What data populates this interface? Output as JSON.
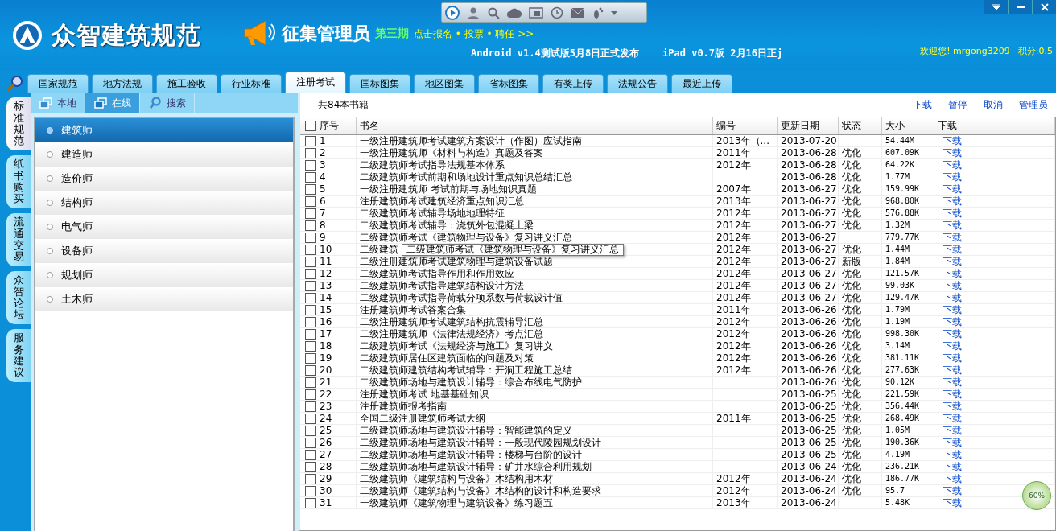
{
  "header": {
    "app_title": "众智建筑规范",
    "promo_title": "征集管理员",
    "promo_issue": "第三期",
    "promo_link": "点击报名 • 投票 • 聘任 >>",
    "news": "Android v1.4测试版5月8日正式发布    iPad v0.7版 2月16日正j",
    "welcome": "欢迎您! mrgong3209",
    "points": "积分:0.5"
  },
  "tabs": [
    {
      "label": "国家规范",
      "selected": false
    },
    {
      "label": "地方法规",
      "selected": false
    },
    {
      "label": "施工验收",
      "selected": false
    },
    {
      "label": "行业标准",
      "selected": false
    },
    {
      "label": "注册考试",
      "selected": true
    },
    {
      "label": "国标图集",
      "selected": false
    },
    {
      "label": "地区图集",
      "selected": false
    },
    {
      "label": "省标图集",
      "selected": false
    },
    {
      "label": "有奖上传",
      "selected": false
    },
    {
      "label": "法规公告",
      "selected": false
    },
    {
      "label": "最近上传",
      "selected": false
    }
  ],
  "side_tabs": [
    {
      "label": "标准规范",
      "selected": true
    },
    {
      "label": "纸书购买",
      "selected": false
    },
    {
      "label": "流通交易",
      "selected": false
    },
    {
      "label": "众智论坛",
      "selected": false
    },
    {
      "label": "服务建议",
      "selected": false
    }
  ],
  "source_tabs": [
    {
      "label": "本地",
      "selected": false,
      "kind": "local"
    },
    {
      "label": "在线",
      "selected": true,
      "kind": "online"
    },
    {
      "label": "搜索",
      "selected": false,
      "kind": "search"
    }
  ],
  "categories": [
    {
      "label": "建筑师",
      "selected": true
    },
    {
      "label": "建造师",
      "selected": false
    },
    {
      "label": "造价师",
      "selected": false
    },
    {
      "label": "结构师",
      "selected": false
    },
    {
      "label": "电气师",
      "selected": false
    },
    {
      "label": "设备师",
      "selected": false
    },
    {
      "label": "规划师",
      "selected": false
    },
    {
      "label": "土木师",
      "selected": false
    }
  ],
  "table": {
    "count": "共84本书籍",
    "actions": [
      "下载",
      "暂停",
      "取消",
      "管理员"
    ],
    "select_all": {
      "checked": false
    },
    "columns": [
      "序号",
      "书名",
      "编号",
      "更新日期",
      "状态",
      "大小",
      "下载"
    ],
    "rows": [
      {
        "checked": false,
        "no": "1",
        "title": "一级注册建筑师考试建筑方案设计（作图）应试指南",
        "code": "2013年（...",
        "date": "2013-07-20",
        "status": "",
        "size": "54.44M",
        "download": "下载"
      },
      {
        "checked": false,
        "no": "2",
        "title": "一级注册建筑师《材料与构造》真题及答案",
        "code": "2011年",
        "date": "2013-06-28",
        "status": "优化",
        "size": "607.09K",
        "download": "下载"
      },
      {
        "checked": false,
        "no": "3",
        "title": "二级建筑师考试指导法规基本体系",
        "code": "2012年",
        "date": "2013-06-28",
        "status": "优化",
        "size": "64.22K",
        "download": "下载"
      },
      {
        "checked": false,
        "no": "4",
        "title": "二级建筑师考试前期和场地设计重点知识总结汇总",
        "code": "",
        "date": "2013-06-28",
        "status": "优化",
        "size": "1.77M",
        "download": "下载"
      },
      {
        "checked": false,
        "no": "5",
        "title": "一级注册建筑师 考试前期与场地知识真题",
        "code": "2007年",
        "date": "2013-06-27",
        "status": "优化",
        "size": "159.99K",
        "download": "下载"
      },
      {
        "checked": false,
        "no": "6",
        "title": "注册建筑师考试建筑经济重点知识汇总",
        "code": "2013年",
        "date": "2013-06-27",
        "status": "优化",
        "size": "968.80K",
        "download": "下载"
      },
      {
        "checked": false,
        "no": "7",
        "title": "二级建筑师考试辅导场地地理特征",
        "code": "2012年",
        "date": "2013-06-27",
        "status": "优化",
        "size": "576.88K",
        "download": "下载"
      },
      {
        "checked": false,
        "no": "8",
        "title": "二级建筑师考试辅导：浇筑外包混凝土梁",
        "code": "2012年",
        "date": "2013-06-27",
        "status": "优化",
        "size": "1.32M",
        "download": "下载"
      },
      {
        "checked": false,
        "no": "9",
        "title": "二级建筑师考试《建筑物理与设备》复习讲义汇总",
        "code": "2012年",
        "date": "2013-06-27",
        "status": "",
        "size": "779.77K",
        "download": "下载"
      },
      {
        "checked": false,
        "no": "10",
        "title": "二级建筑",
        "code": "2012年",
        "date": "2013-06-27",
        "status": "优化",
        "size": "1.44M",
        "download": "下载"
      },
      {
        "checked": false,
        "no": "11",
        "title": "二级注册建筑师考试建筑物理与建筑设备试题",
        "code": "2012年",
        "date": "2013-06-27",
        "status": "新版",
        "size": "1.84M",
        "download": "下载"
      },
      {
        "checked": false,
        "no": "12",
        "title": "二级建筑师考试指导作用和作用效应",
        "code": "2012年",
        "date": "2013-06-27",
        "status": "优化",
        "size": "121.57K",
        "download": "下载"
      },
      {
        "checked": false,
        "no": "13",
        "title": "二级建筑师考试指导建筑结构设计方法",
        "code": "2012年",
        "date": "2013-06-27",
        "status": "优化",
        "size": "99.03K",
        "download": "下载"
      },
      {
        "checked": false,
        "no": "14",
        "title": "二级建筑师考试指导荷载分项系数与荷载设计值",
        "code": "2012年",
        "date": "2013-06-27",
        "status": "优化",
        "size": "129.47K",
        "download": "下载"
      },
      {
        "checked": false,
        "no": "15",
        "title": "注册建筑师考试答案合集",
        "code": "2011年",
        "date": "2013-06-26",
        "status": "优化",
        "size": "1.79M",
        "download": "下载"
      },
      {
        "checked": false,
        "no": "16",
        "title": "二级注册建筑师考试建筑结构抗震辅导汇总",
        "code": "2012年",
        "date": "2013-06-26",
        "status": "优化",
        "size": "1.19M",
        "download": "下载"
      },
      {
        "checked": false,
        "no": "17",
        "title": "二级注册建筑师《法律法规经济》考点汇总",
        "code": "2012年",
        "date": "2013-06-26",
        "status": "优化",
        "size": "998.30K",
        "download": "下载"
      },
      {
        "checked": false,
        "no": "18",
        "title": "二级建筑师考试《法规经济与施工》复习讲义",
        "code": "2012年",
        "date": "2013-06-26",
        "status": "优化",
        "size": "3.14M",
        "download": "下载"
      },
      {
        "checked": false,
        "no": "19",
        "title": "二级建筑师居住区建筑面临的问题及对策",
        "code": "2012年",
        "date": "2013-06-26",
        "status": "优化",
        "size": "381.11K",
        "download": "下载"
      },
      {
        "checked": false,
        "no": "20",
        "title": "二级建筑师建筑结构考试辅导：开洞工程施工总结",
        "code": "2012年",
        "date": "2013-06-26",
        "status": "优化",
        "size": "277.63K",
        "download": "下载"
      },
      {
        "checked": false,
        "no": "21",
        "title": "二级建筑师场地与建筑设计辅导：综合布线电气防护",
        "code": "",
        "date": "2013-06-26",
        "status": "优化",
        "size": "90.12K",
        "download": "下载"
      },
      {
        "checked": false,
        "no": "22",
        "title": "注册建筑师考试 地基基础知识",
        "code": "",
        "date": "2013-06-25",
        "status": "优化",
        "size": "221.59K",
        "download": "下载"
      },
      {
        "checked": false,
        "no": "23",
        "title": "注册建筑师报考指南",
        "code": "",
        "date": "2013-06-25",
        "status": "优化",
        "size": "356.44K",
        "download": "下载"
      },
      {
        "checked": false,
        "no": "24",
        "title": "全国二级注册建筑师考试大纲",
        "code": "2011年",
        "date": "2013-06-25",
        "status": "优化",
        "size": "268.49K",
        "download": "下载"
      },
      {
        "checked": false,
        "no": "25",
        "title": "二级建筑师场地与建筑设计辅导：智能建筑的定义",
        "code": "",
        "date": "2013-06-25",
        "status": "优化",
        "size": "1.05M",
        "download": "下载"
      },
      {
        "checked": false,
        "no": "26",
        "title": "二级建筑师场地与建筑设计辅导：一般现代陵园规划设计",
        "code": "",
        "date": "2013-06-25",
        "status": "优化",
        "size": "190.36K",
        "download": "下载"
      },
      {
        "checked": false,
        "no": "27",
        "title": "二级建筑师场地与建筑设计辅导：楼梯与台阶的设计",
        "code": "",
        "date": "2013-06-25",
        "status": "优化",
        "size": "4.19M",
        "download": "下载"
      },
      {
        "checked": false,
        "no": "28",
        "title": "二级建筑师场地与建筑设计辅导：矿井水综合利用规划",
        "code": "",
        "date": "2013-06-24",
        "status": "优化",
        "size": "236.21K",
        "download": "下载"
      },
      {
        "checked": false,
        "no": "29",
        "title": "二级建筑师《建筑结构与设备》木结构用木材",
        "code": "2012年",
        "date": "2013-06-24",
        "status": "优化",
        "size": "186.77K",
        "download": "下载"
      },
      {
        "checked": false,
        "no": "30",
        "title": "二级建筑师《建筑结构与设备》木结构的设计和构造要求",
        "code": "2012年",
        "date": "2013-06-24",
        "status": "优化",
        "size": "95.7",
        "download": "下载"
      },
      {
        "checked": false,
        "no": "31",
        "title": "一级建筑师《建筑物理与建筑设备》练习题五",
        "code": "2013年",
        "date": "2013-06-24",
        "status": "",
        "size": "5.48K",
        "download": "下载"
      }
    ],
    "tooltip": "二级建筑师考试《建筑物理与设备》复习讲义汇总"
  },
  "speed_ball": "60%"
}
